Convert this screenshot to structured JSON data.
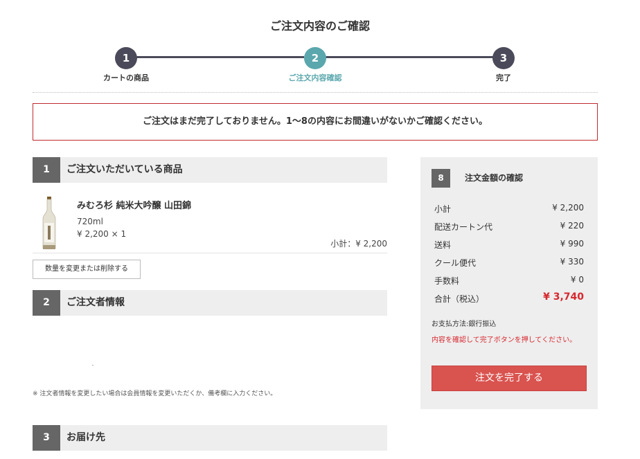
{
  "page": {
    "title": "ご注文内容のご確認"
  },
  "stepper": {
    "steps": [
      {
        "num": "1",
        "label": "カートの商品"
      },
      {
        "num": "2",
        "label": "ご注文内容確認"
      },
      {
        "num": "3",
        "label": "完了"
      }
    ],
    "colors": {
      "default": "#4a4a5a",
      "active": "#5aa7ad"
    }
  },
  "notice": {
    "text": "ご注文はまだ完了しておりません。1〜8の内容にお間違いがないかご確認ください。"
  },
  "sections": [
    {
      "num": "1",
      "title": "ご注文いただいている商品"
    },
    {
      "num": "2",
      "title": "ご注文者情報"
    },
    {
      "num": "3",
      "title": "お届け先"
    }
  ],
  "product": {
    "name": "みむろ杉 純米大吟醸 山田錦",
    "volume": "720ml",
    "price_qty": "¥ 2,200 × 1",
    "subtotal": "小計：¥ 2,200",
    "image": "sake-bottle-icon"
  },
  "change_button": {
    "label": "数量を変更または削除する"
  },
  "orderer_note": "※ 注文者情報を変更したい場合は会員情報を変更いただくか、備考欄に入力ください。",
  "summary": {
    "num": "8",
    "title": "注文金額の確認",
    "rows": [
      {
        "label": "小計",
        "value": "¥ 2,200"
      },
      {
        "label": "配送カートン代",
        "value": "¥ 220"
      },
      {
        "label": "送料",
        "value": "¥ 990"
      },
      {
        "label": "クール便代",
        "value": "¥ 330"
      },
      {
        "label": "手数料",
        "value": "¥ 0"
      },
      {
        "label": "合計（税込）",
        "value": "¥ 3,740"
      }
    ],
    "payment_method": "お支払方法:銀行振込",
    "instruction": "内容を確認して完了ボタンを押してください。",
    "submit_label": "注文を完了する",
    "accent_color": "#d7282f"
  }
}
